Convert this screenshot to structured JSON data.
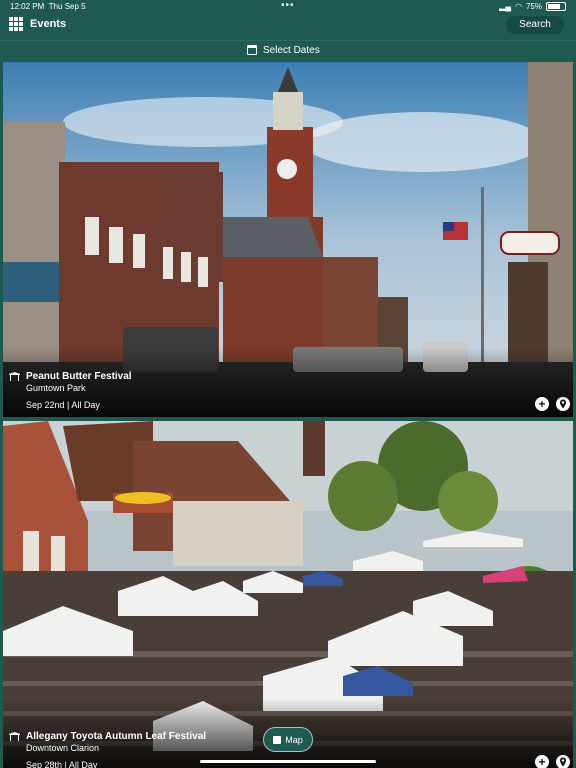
{
  "status": {
    "time": "12:02 PM",
    "date": "Thu Sep 5",
    "battery": "75%",
    "battery_level": 0.75
  },
  "nav": {
    "title": "Events",
    "search_label": "Search",
    "menu_icon": "grid-icon"
  },
  "datebar": {
    "label": "Select Dates",
    "icon": "calendar-icon"
  },
  "events": [
    {
      "title": "Peanut Butter Festival",
      "venue": "Gumtown Park",
      "when": "Sep 22nd | All Day"
    },
    {
      "title": "Allegany Toyota Autumn Leaf Festival",
      "venue": "Downtown Clarion",
      "when": "Sep 28th | All Day"
    }
  ],
  "actions": {
    "add_label": "+"
  },
  "map_button": {
    "label": "Map"
  },
  "colors": {
    "brand": "#1f5a50",
    "brand_dark": "#164a41"
  }
}
